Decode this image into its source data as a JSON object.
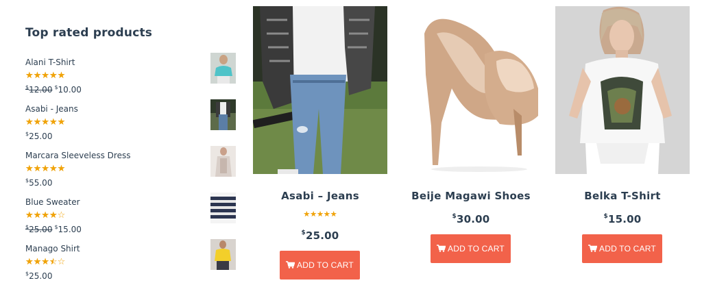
{
  "sidebar": {
    "title": "Top rated products",
    "items": [
      {
        "name": "Alani T-Shirt",
        "rating": 5,
        "old_currency": "$",
        "old_price": "12.00",
        "currency": "$",
        "price": "10.00"
      },
      {
        "name": "Asabi - Jeans",
        "rating": 5,
        "old_currency": "",
        "old_price": "",
        "currency": "$",
        "price": "25.00"
      },
      {
        "name": "Marcara Sleeveless Dress",
        "rating": 5,
        "old_currency": "",
        "old_price": "",
        "currency": "$",
        "price": "55.00"
      },
      {
        "name": "Blue Sweater",
        "rating": 4,
        "old_currency": "$",
        "old_price": "25.00",
        "currency": "$",
        "price": "15.00"
      },
      {
        "name": "Manago Shirt",
        "rating": 3.5,
        "old_currency": "",
        "old_price": "",
        "currency": "$",
        "price": "25.00"
      }
    ]
  },
  "products": [
    {
      "title": "Asabi – Jeans",
      "rating": 5,
      "currency": "$",
      "price": "25.00",
      "button": "ADD TO CART"
    },
    {
      "title": "Beije Magawi Shoes",
      "currency": "$",
      "price": "30.00",
      "button": "ADD TO CART"
    },
    {
      "title": "Belka T-Shirt",
      "currency": "$",
      "price": "15.00",
      "button": "ADD TO CART"
    }
  ],
  "colors": {
    "accent": "#f2624a",
    "star": "#f0a30a",
    "text": "#2c3e50"
  },
  "icons": {
    "cart": "shopping-cart-icon",
    "star": "star-icon"
  }
}
